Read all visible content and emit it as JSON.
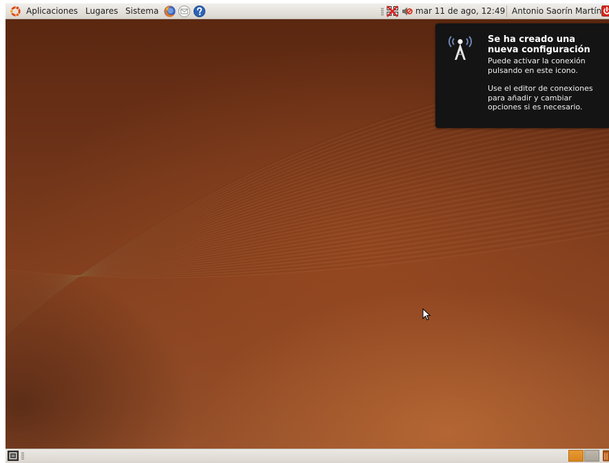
{
  "top_panel": {
    "menus": {
      "aplicaciones": "Aplicaciones",
      "lugares": "Lugares",
      "sistema": "Sistema"
    },
    "launchers": [
      "firefox-icon",
      "mail-icon",
      "help-icon"
    ],
    "clock": "mar 11 de ago, 12:49",
    "username": "Antonio Saorín Martínez",
    "tray_icons": [
      "network-icon",
      "volume-icon",
      "shutdown-icon"
    ]
  },
  "notification": {
    "title": "Se ha creado una nueva configuración",
    "body_1": "Puede activar la conexión pulsando en este icono.",
    "body_2": "Use el editor de conexiones para añadir y cambiar opciones si es necesario.",
    "icon": "wireless-antenna-icon"
  },
  "bottom_panel": {
    "workspaces": 2,
    "active_workspace": 1,
    "icons": [
      "show-desktop-icon",
      "trash-icon"
    ]
  },
  "colors": {
    "panel": "#dedad3",
    "desktop": "#7a3a1b",
    "notification_bg": "#141414",
    "workspace_active": "#e09030"
  }
}
